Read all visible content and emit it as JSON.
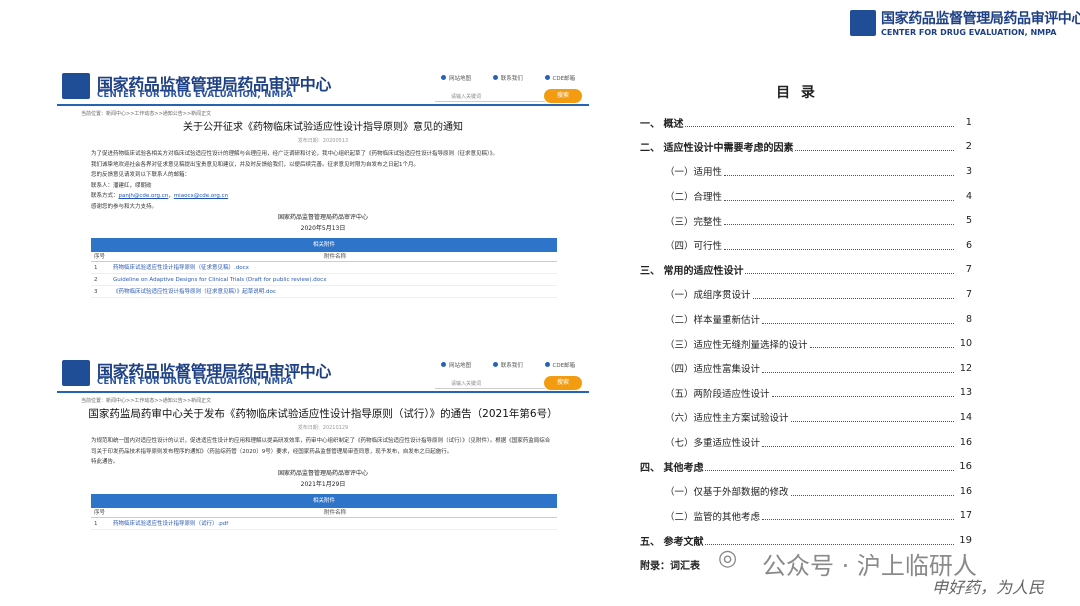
{
  "brand": {
    "zh": "国家药品监督管理局药品审评中心",
    "en": "CENTER FOR DRUG EVALUATION, NMPA"
  },
  "site_header": {
    "zh": "国家药品监督管理局药品审评中心",
    "en": "CENTER FOR DRUG EVALUATION, NMPA",
    "links": [
      "网站地图",
      "联系我们",
      "CDE邮箱"
    ],
    "search_placeholder": "请输入关键词",
    "search_button": "搜索"
  },
  "notice1": {
    "breadcrumb": "当前位置：新闻中心>>工作动态>>通知公告>>新闻正文",
    "title": "关于公开征求《药物临床试验适应性设计指导原则》意见的通知",
    "publish": "发布日期：20200513",
    "paragraphs": [
      "为了促进药物临床试验各相关方对临床试验适应性设计的理解与合理应用，经广泛调研和讨论，我中心组织起草了《药物临床试验适应性设计指导原则（征求意见稿）》。",
      "我们诚挚地欢迎社会各界对征求意见稿提出宝贵意见和建议，并及时反馈给我们，以便后续完善。征求意见时限为自发布之日起1个月。",
      "您的反馈意见请发到以下联系人的邮箱：",
      "联系人：潘建红，缪朝勋"
    ],
    "contact_prefix": "联系方式：",
    "email1": "panjh@cde.org.cn",
    "email2": "miaocx@cde.org.cn",
    "thanks": "感谢您的参与和大力支持。",
    "signature": "国家药品监督管理局药品审评中心",
    "date": "2020年5月13日",
    "attach_header": "相关附件",
    "col_no": "序号",
    "col_name": "附件名称",
    "attachments": [
      {
        "no": "1",
        "name": "药物临床试验适应性设计指导原则（征求意见稿）.docx"
      },
      {
        "no": "2",
        "name": "Guideline on Adaptive Designs for Clinical Trials (Draft for public review).docx"
      },
      {
        "no": "3",
        "name": "《药物临床试验适应性设计指导原则（征求意见稿）》起草说明.doc"
      }
    ]
  },
  "notice2": {
    "breadcrumb": "当前位置：新闻中心>>工作动态>>通知公告>>新闻正文",
    "title": "国家药监局药审中心关于发布《药物临床试验适应性设计指导原则（试行）》的通告（2021年第6号）",
    "publish": "发布日期：20210129",
    "paragraphs": [
      "为规范和统一国内对适应性设计的认识，促进适应性设计的应用和理解以提高研发效率，药审中心组织制定了《药物临床试验适应性设计指导原则（试行）》（见附件）。根据《国家药监局综合司关于印发药品技术指导原则发布程序的通知》（药监综药管〔2020〕9号）要求，经国家药品监督管理局审查同意，现予发布，自发布之日起施行。",
      "特此通告。"
    ],
    "signature": "国家药品监督管理局药品审评中心",
    "date": "2021年1月29日",
    "attach_header": "相关附件",
    "col_no": "序号",
    "col_name": "附件名称",
    "attachments": [
      {
        "no": "1",
        "name": "药物临床试验适应性设计指导原则（试行）.pdf"
      }
    ]
  },
  "toc": {
    "title": "目 录",
    "entries": [
      {
        "label": "一、  概述",
        "page": "1",
        "level": 1
      },
      {
        "label": "二、  适应性设计中需要考虑的因素",
        "page": "2",
        "level": 1
      },
      {
        "label": "（一）适用性",
        "page": "3",
        "level": 2
      },
      {
        "label": "（二）合理性",
        "page": "4",
        "level": 2
      },
      {
        "label": "（三）完整性",
        "page": "5",
        "level": 2
      },
      {
        "label": "（四）可行性",
        "page": "6",
        "level": 2
      },
      {
        "label": "三、  常用的适应性设计",
        "page": "7",
        "level": 1
      },
      {
        "label": "（一）成组序贯设计",
        "page": "7",
        "level": 2
      },
      {
        "label": "（二）样本量重新估计",
        "page": "8",
        "level": 2
      },
      {
        "label": "（三）适应性无缝剂量选择的设计",
        "page": "10",
        "level": 2
      },
      {
        "label": "（四）适应性富集设计",
        "page": "12",
        "level": 2
      },
      {
        "label": "（五）两阶段适应性设计",
        "page": "13",
        "level": 2
      },
      {
        "label": "（六）适应性主方案试验设计",
        "page": "14",
        "level": 2
      },
      {
        "label": "（七）多重适应性设计",
        "page": "16",
        "level": 2
      },
      {
        "label": "四、  其他考虑",
        "page": "16",
        "level": 1
      },
      {
        "label": "（一）仅基于外部数据的修改",
        "page": "16",
        "level": 2
      },
      {
        "label": "（二）监管的其他考虑",
        "page": "17",
        "level": 2
      },
      {
        "label": "五、  参考文献",
        "page": "19",
        "level": 1
      },
      {
        "label": "附录：词汇表",
        "page": "",
        "level": 1
      }
    ]
  },
  "watermark": {
    "line1": "公众号 · 沪上临研人",
    "line2": "申好药，为人民"
  },
  "colors": {
    "brand_blue": "#1d3f83",
    "table_header": "#2e74c8",
    "search_button": "#f39c12",
    "link": "#1f53b5"
  }
}
